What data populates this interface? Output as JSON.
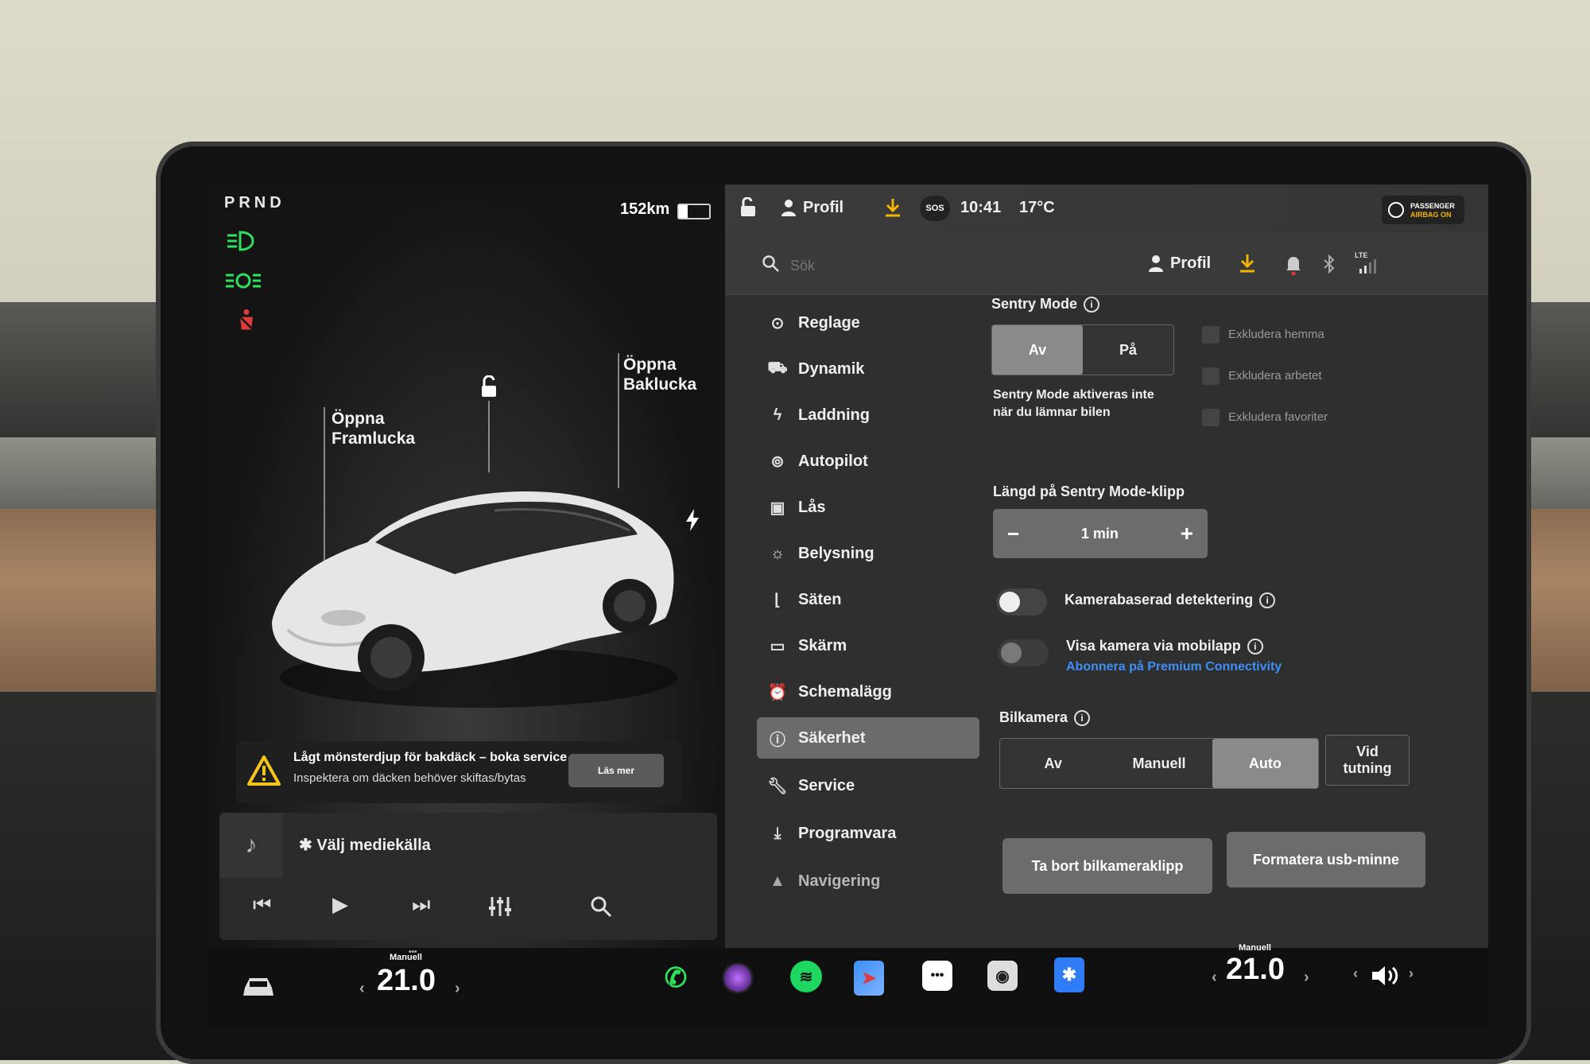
{
  "left": {
    "gear": "PRND",
    "range": "152km",
    "battery_level": 0.3,
    "callout_front": [
      "Öppna",
      "Framlucka"
    ],
    "callout_rear": [
      "Öppna",
      "Baklucka"
    ],
    "alert": {
      "line1": "Lågt mönsterdjup för bakdäck – boka service",
      "line2": "Inspektera om däcken behöver skiftas/bytas",
      "button": "Läs mer"
    },
    "media": {
      "source": "Välj mediekälla"
    }
  },
  "statusbar": {
    "profile": "Profil",
    "sos": "SOS",
    "time": "10:41",
    "temperature": "17°C",
    "airbag_line1": "PASSENGER",
    "airbag_line2": "AIRBAG ON"
  },
  "search": {
    "placeholder": "Sök",
    "profile": "Profil",
    "lte": "LTE"
  },
  "menu": [
    {
      "label": "Reglage",
      "icon": "toggle-icon"
    },
    {
      "label": "Dynamik",
      "icon": "car-icon"
    },
    {
      "label": "Laddning",
      "icon": "bolt-icon"
    },
    {
      "label": "Autopilot",
      "icon": "steering-wheel-icon"
    },
    {
      "label": "Lås",
      "icon": "lock-icon"
    },
    {
      "label": "Belysning",
      "icon": "sun-icon"
    },
    {
      "label": "Säten",
      "icon": "seat-icon"
    },
    {
      "label": "Skärm",
      "icon": "screen-icon"
    },
    {
      "label": "Schemalägg",
      "icon": "alarm-clock-icon"
    },
    {
      "label": "Säkerhet",
      "icon": "info-circle-icon",
      "active": true
    },
    {
      "label": "Service",
      "icon": "wrench-icon"
    },
    {
      "label": "Programvara",
      "icon": "download-icon"
    },
    {
      "label": "Navigering",
      "icon": "navigation-icon"
    }
  ],
  "content": {
    "sentry_title": "Sentry Mode",
    "sentry_off": "Av",
    "sentry_on": "På",
    "sentry_desc1": "Sentry Mode aktiveras inte",
    "sentry_desc2": "när du lämnar bilen",
    "exclude_home": "Exkludera hemma",
    "exclude_work": "Exkludera arbetet",
    "exclude_fav": "Exkludera favoriter",
    "clip_length_title": "Längd på Sentry Mode-klipp",
    "clip_minus": "−",
    "clip_value": "1 min",
    "clip_plus": "+",
    "camera_detect": "Kamerabaserad detektering",
    "view_camera": "Visa kamera via mobilapp",
    "premium_link": "Abonnera på Premium Connectivity",
    "dashcam_title": "Bilkamera",
    "dashcam_off": "Av",
    "dashcam_manual": "Manuell",
    "dashcam_auto": "Auto",
    "dashcam_honk1": "Vid",
    "dashcam_honk2": "tutning",
    "delete_clips": "Ta bort bilkameraklipp",
    "format_usb": "Formatera usb-minne"
  },
  "taskbar": {
    "left_mode": "Manuell",
    "left_temp": "21.0",
    "right_mode": "Manuell",
    "right_temp": "21.0",
    "dots": "•••"
  },
  "colors": {
    "accent_blue": "#3e8ef7",
    "download_yellow": "#f5b400",
    "indicator_green": "#2ee05a",
    "indicator_red": "#e03a3a",
    "alert_yellow": "#f5c518"
  }
}
